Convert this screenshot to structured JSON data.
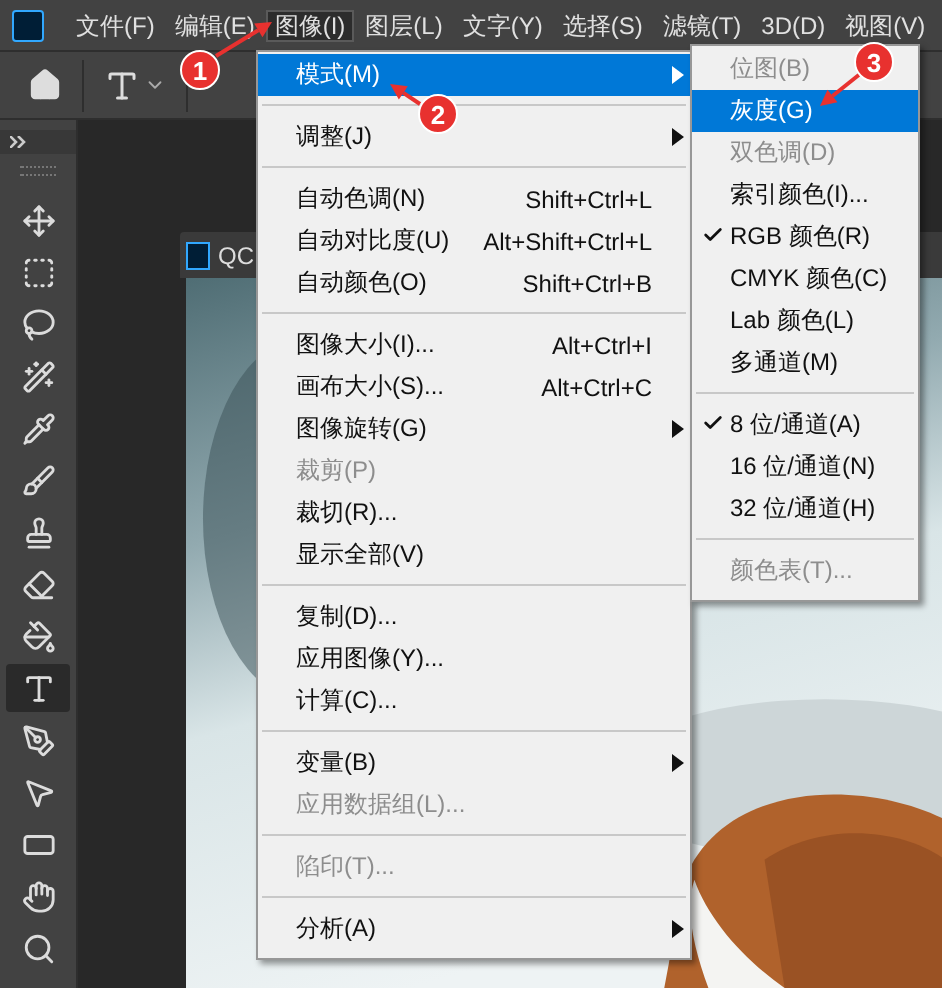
{
  "menu_bar": {
    "items": [
      {
        "label": "文件(F)",
        "selected": false
      },
      {
        "label": "编辑(E)",
        "selected": false
      },
      {
        "label": "图像(I)",
        "selected": true
      },
      {
        "label": "图层(L)",
        "selected": false
      },
      {
        "label": "文字(Y)",
        "selected": false
      },
      {
        "label": "选择(S)",
        "selected": false
      },
      {
        "label": "滤镜(T)",
        "selected": false
      },
      {
        "label": "3D(D)",
        "selected": false
      },
      {
        "label": "视图(V)",
        "selected": false
      }
    ]
  },
  "tools": [
    {
      "selected": false
    },
    {
      "selected": false
    },
    {
      "selected": false
    },
    {
      "selected": false
    },
    {
      "selected": false
    },
    {
      "selected": false
    },
    {
      "selected": false
    },
    {
      "selected": false
    },
    {
      "selected": false
    },
    {
      "selected": true
    },
    {
      "selected": false
    },
    {
      "selected": false
    },
    {
      "selected": false
    },
    {
      "selected": false
    },
    {
      "selected": false
    }
  ],
  "document": {
    "title": "QC"
  },
  "image_menu": {
    "entries": [
      {
        "kind": "item",
        "label": "模式(M)",
        "submenu": true,
        "selected": true,
        "disabled": false
      },
      {
        "kind": "separator"
      },
      {
        "kind": "item",
        "label": "调整(J)",
        "submenu": true,
        "selected": false,
        "disabled": false
      },
      {
        "kind": "separator"
      },
      {
        "kind": "item",
        "label": "自动色调(N)",
        "shortcut": "Shift+Ctrl+L",
        "selected": false,
        "disabled": false
      },
      {
        "kind": "item",
        "label": "自动对比度(U)",
        "shortcut": "Alt+Shift+Ctrl+L",
        "selected": false,
        "disabled": false
      },
      {
        "kind": "item",
        "label": "自动颜色(O)",
        "shortcut": "Shift+Ctrl+B",
        "selected": false,
        "disabled": false
      },
      {
        "kind": "separator"
      },
      {
        "kind": "item",
        "label": "图像大小(I)...",
        "shortcut": "Alt+Ctrl+I",
        "selected": false,
        "disabled": false
      },
      {
        "kind": "item",
        "label": "画布大小(S)...",
        "shortcut": "Alt+Ctrl+C",
        "selected": false,
        "disabled": false
      },
      {
        "kind": "item",
        "label": "图像旋转(G)",
        "submenu": true,
        "selected": false,
        "disabled": false
      },
      {
        "kind": "item",
        "label": "裁剪(P)",
        "selected": false,
        "disabled": true
      },
      {
        "kind": "item",
        "label": "裁切(R)...",
        "selected": false,
        "disabled": false
      },
      {
        "kind": "item",
        "label": "显示全部(V)",
        "selected": false,
        "disabled": false
      },
      {
        "kind": "separator"
      },
      {
        "kind": "item",
        "label": "复制(D)...",
        "selected": false,
        "disabled": false
      },
      {
        "kind": "item",
        "label": "应用图像(Y)...",
        "selected": false,
        "disabled": false
      },
      {
        "kind": "item",
        "label": "计算(C)...",
        "selected": false,
        "disabled": false
      },
      {
        "kind": "separator"
      },
      {
        "kind": "item",
        "label": "变量(B)",
        "submenu": true,
        "selected": false,
        "disabled": false
      },
      {
        "kind": "item",
        "label": "应用数据组(L)...",
        "selected": false,
        "disabled": true
      },
      {
        "kind": "separator"
      },
      {
        "kind": "item",
        "label": "陷印(T)...",
        "selected": false,
        "disabled": true
      },
      {
        "kind": "separator"
      },
      {
        "kind": "item",
        "label": "分析(A)",
        "submenu": true,
        "selected": false,
        "disabled": false
      }
    ]
  },
  "mode_submenu": {
    "entries": [
      {
        "kind": "item",
        "label": "位图(B)",
        "checked": false,
        "selected": false,
        "disabled": true
      },
      {
        "kind": "item",
        "label": "灰度(G)",
        "checked": false,
        "selected": true,
        "disabled": false
      },
      {
        "kind": "item",
        "label": "双色调(D)",
        "checked": false,
        "selected": false,
        "disabled": true
      },
      {
        "kind": "item",
        "label": "索引颜色(I)...",
        "checked": false,
        "selected": false,
        "disabled": false
      },
      {
        "kind": "item",
        "label": "RGB 颜色(R)",
        "checked": true,
        "selected": false,
        "disabled": false
      },
      {
        "kind": "item",
        "label": "CMYK 颜色(C)",
        "checked": false,
        "selected": false,
        "disabled": false
      },
      {
        "kind": "item",
        "label": "Lab 颜色(L)",
        "checked": false,
        "selected": false,
        "disabled": false
      },
      {
        "kind": "item",
        "label": "多通道(M)",
        "checked": false,
        "selected": false,
        "disabled": false
      },
      {
        "kind": "separator"
      },
      {
        "kind": "item",
        "label": "8 位/通道(A)",
        "checked": true,
        "selected": false,
        "disabled": false
      },
      {
        "kind": "item",
        "label": "16 位/通道(N)",
        "checked": false,
        "selected": false,
        "disabled": false
      },
      {
        "kind": "item",
        "label": "32 位/通道(H)",
        "checked": false,
        "selected": false,
        "disabled": false
      },
      {
        "kind": "separator"
      },
      {
        "kind": "item",
        "label": "颜色表(T)...",
        "checked": false,
        "selected": false,
        "disabled": true
      }
    ]
  },
  "annotations": [
    {
      "label": "1"
    },
    {
      "label": "2"
    },
    {
      "label": "3"
    }
  ]
}
